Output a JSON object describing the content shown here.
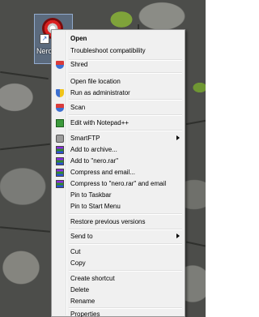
{
  "desktop_icon": {
    "label": "Nero ...",
    "icon": "nero-shortcut-icon"
  },
  "context_menu": {
    "items": [
      {
        "label": "Open",
        "bold": true,
        "icon": ""
      },
      {
        "label": "Troubleshoot compatibility",
        "icon": ""
      },
      {
        "label": "Shred",
        "icon": "shred-shield-icon"
      },
      {
        "label": "Open file location",
        "icon": ""
      },
      {
        "label": "Run as administrator",
        "icon": "uac-shield-icon"
      },
      {
        "label": "Scan",
        "icon": "scan-shield-icon"
      },
      {
        "label": "Edit with Notepad++",
        "icon": "notepad-plus-plus-icon"
      },
      {
        "label": "SmartFTP",
        "icon": "smartftp-icon",
        "submenu": true
      },
      {
        "label": "Add to archive...",
        "icon": "winrar-icon"
      },
      {
        "label": "Add to \"nero.rar\"",
        "icon": "winrar-icon"
      },
      {
        "label": "Compress and email...",
        "icon": "winrar-icon"
      },
      {
        "label": "Compress to \"nero.rar\" and email",
        "icon": "winrar-icon"
      },
      {
        "label": "Pin to Taskbar",
        "icon": ""
      },
      {
        "label": "Pin to Start Menu",
        "icon": ""
      },
      {
        "label": "Restore previous versions",
        "icon": ""
      },
      {
        "label": "Send to",
        "icon": "",
        "submenu": true
      },
      {
        "label": "Cut",
        "icon": ""
      },
      {
        "label": "Copy",
        "icon": ""
      },
      {
        "label": "Create shortcut",
        "icon": ""
      },
      {
        "label": "Delete",
        "icon": ""
      },
      {
        "label": "Rename",
        "icon": ""
      },
      {
        "label": "Properties",
        "icon": ""
      }
    ]
  }
}
